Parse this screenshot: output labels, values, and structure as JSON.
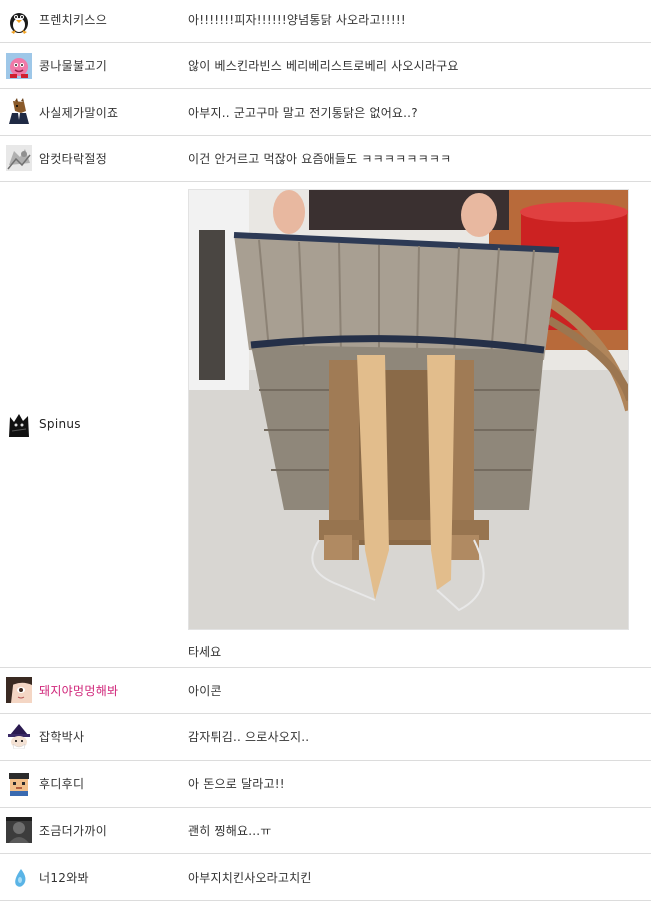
{
  "comments": [
    {
      "nickname": "프렌치키스으",
      "text": "아!!!!!!!피자!!!!!!양념통닭 사오라고!!!!!",
      "avatar_icon": "penguin-icon"
    },
    {
      "nickname": "콩나물불고기",
      "text": "않이 베스킨라빈스 베리베리스트로베리 사오시라구요",
      "avatar_icon": "pink-character-icon"
    },
    {
      "nickname": "사실제가말이죠",
      "text": "아부지.. 군고구마 말고 전기통닭은 없어요..?",
      "avatar_icon": "horse-suit-icon"
    },
    {
      "nickname": "암컷타락절정",
      "text": "이건 안거르고 먹잖아 요즘애들도 ㅋㅋㅋㅋㅋㅋㅋㅋ",
      "avatar_icon": "gray-sketch-icon"
    },
    {
      "nickname": "Spinus",
      "text": "타세요",
      "avatar_icon": "black-cat-icon",
      "image_alt": "A-frame wooden carrier (jige) with a woven basket and cloth shoulder straps"
    },
    {
      "nickname": "돼지야멍멍해봐",
      "text": "아이콘",
      "avatar_icon": "anime-face-icon"
    },
    {
      "nickname": "잡학박사",
      "text": "감자튀김.. 으로사오지..",
      "avatar_icon": "wizard-hat-icon"
    },
    {
      "nickname": "후디후디",
      "text": "아 돈으로 달라고!!",
      "avatar_icon": "pixel-face-icon"
    },
    {
      "nickname": "조금더가까이",
      "text": "괜히 찡해요...ㅠ",
      "avatar_icon": "dark-photo-icon"
    },
    {
      "nickname": "너12와봐",
      "text": "아부지치킨사오라고치킨",
      "avatar_icon": "blue-water-drop-icon"
    }
  ],
  "colors": {
    "border": "#dcdcdc",
    "text": "#333333",
    "highlight_nick": "#d0267a"
  }
}
